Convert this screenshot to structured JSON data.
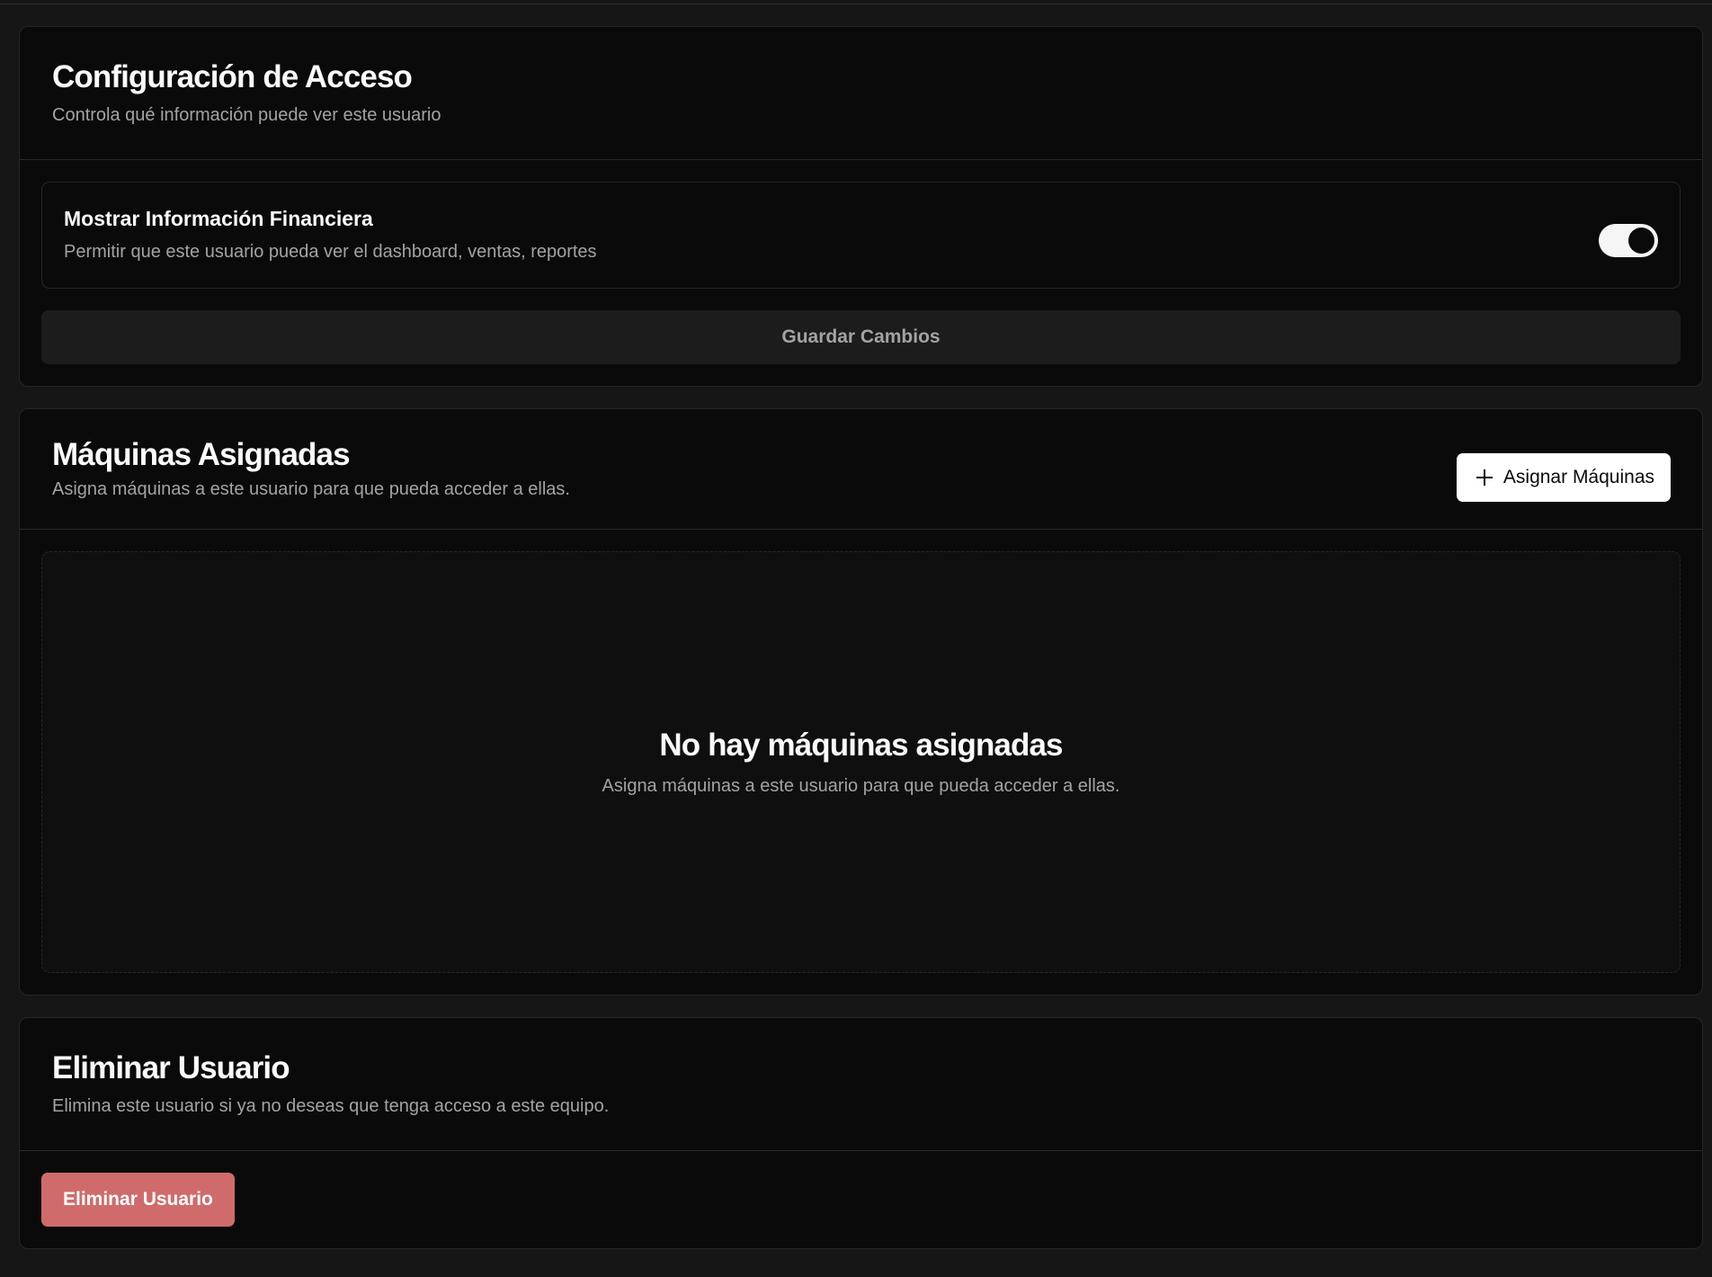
{
  "access_config": {
    "title": "Configuración de Acceso",
    "description": "Controla qué información puede ver este usuario",
    "financial_toggle": {
      "title": "Mostrar Información Financiera",
      "description": "Permitir que este usuario pueda ver el dashboard, ventas, reportes",
      "enabled": true
    },
    "save_label": "Guardar Cambios"
  },
  "machines": {
    "title": "Máquinas Asignadas",
    "description": "Asigna máquinas a este usuario para que pueda acceder a ellas.",
    "assign_label": "Asignar Máquinas",
    "assign_icon": "plus-icon",
    "empty_title": "No hay máquinas asignadas",
    "empty_description": "Asigna máquinas a este usuario para que pueda acceder a ellas."
  },
  "delete_user": {
    "title": "Eliminar Usuario",
    "description": "Elimina este usuario si ya no deseas que tenga acceso a este equipo.",
    "button_label": "Eliminar Usuario"
  },
  "colors": {
    "background": "#161616",
    "card": "#0a0a0a",
    "destructive": "#d06b6b",
    "muted_text": "#a3a3a3"
  }
}
